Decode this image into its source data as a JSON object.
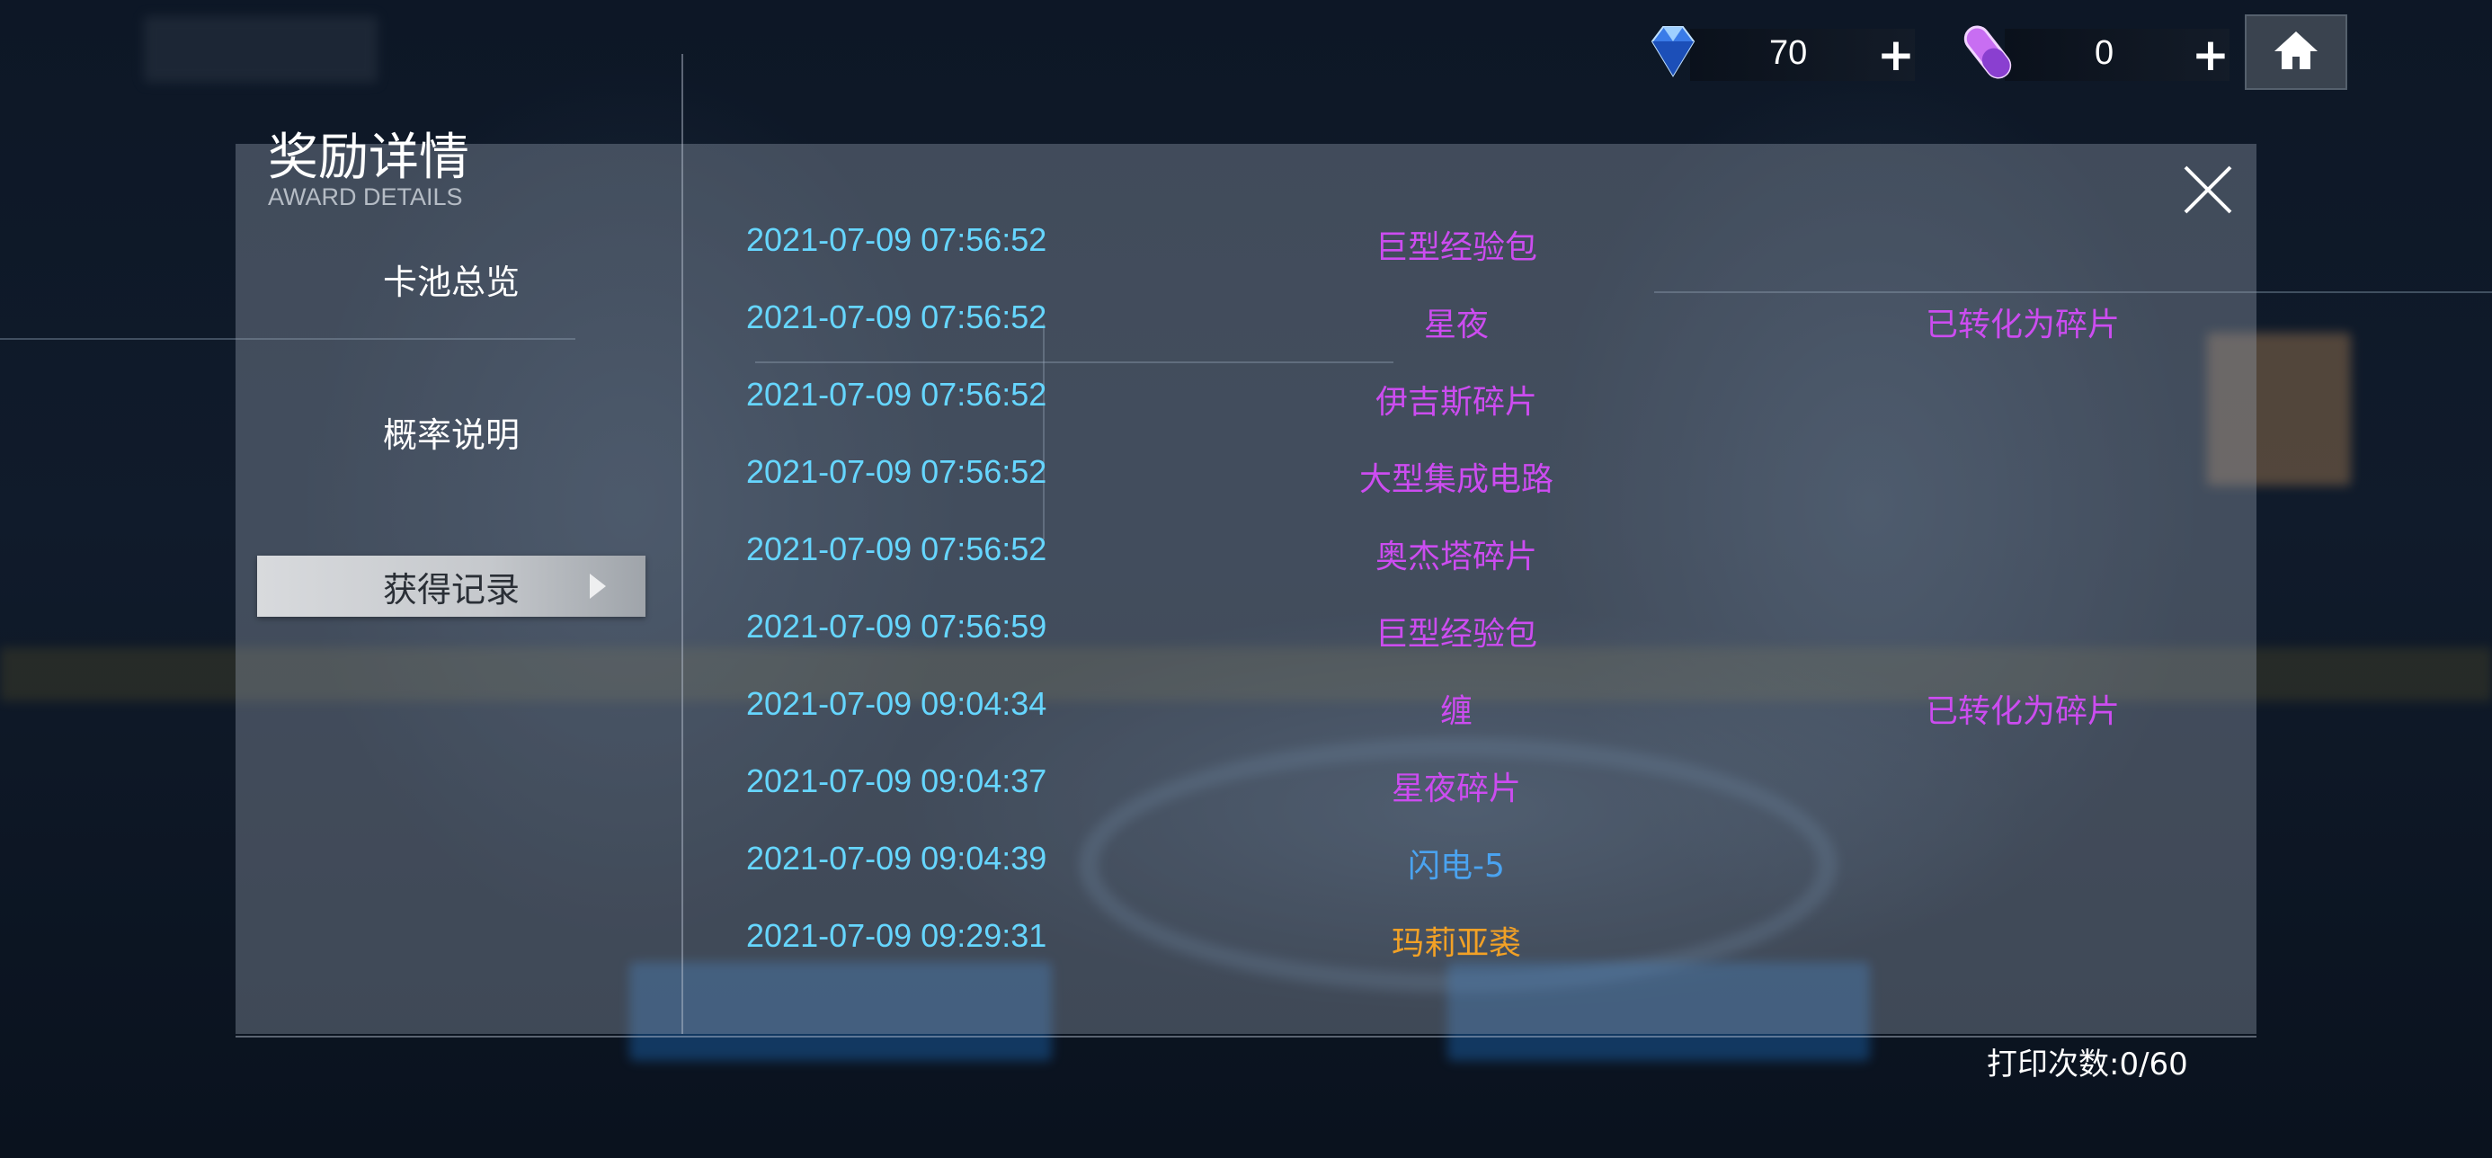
{
  "colors": {
    "time": "#66d6ff",
    "purple_item": "#cc4cf0",
    "blue_item": "#4aa3f0",
    "orange_item": "#f2a126",
    "panel": "rgba(150,160,175,0.38)"
  },
  "currencies": [
    {
      "icon": "diamond-icon",
      "value": "70",
      "plus": "+"
    },
    {
      "icon": "capsule-icon",
      "value": "0",
      "plus": "+"
    }
  ],
  "home_icon": "home-icon",
  "dialog": {
    "title": "奖励详情",
    "subtitle": "AWARD DETAILS",
    "close_icon": "close-icon"
  },
  "menu": {
    "items": [
      {
        "label": "卡池总览",
        "active": false
      },
      {
        "label": "概率说明",
        "active": false
      },
      {
        "label": "获得记录",
        "active": true
      }
    ]
  },
  "records": [
    {
      "time": "2021-07-09 07:56:52",
      "name": "巨型经验包",
      "note": "",
      "color": "purple"
    },
    {
      "time": "2021-07-09 07:56:52",
      "name": "星夜",
      "note": "已转化为碎片",
      "color": "purple"
    },
    {
      "time": "2021-07-09 07:56:52",
      "name": "伊吉斯碎片",
      "note": "",
      "color": "purple"
    },
    {
      "time": "2021-07-09 07:56:52",
      "name": "大型集成电路",
      "note": "",
      "color": "purple"
    },
    {
      "time": "2021-07-09 07:56:52",
      "name": "奥杰塔碎片",
      "note": "",
      "color": "purple"
    },
    {
      "time": "2021-07-09 07:56:59",
      "name": "巨型经验包",
      "note": "",
      "color": "purple"
    },
    {
      "time": "2021-07-09 09:04:34",
      "name": "缠",
      "note": "已转化为碎片",
      "color": "purple"
    },
    {
      "time": "2021-07-09 09:04:37",
      "name": "星夜碎片",
      "note": "",
      "color": "purple"
    },
    {
      "time": "2021-07-09 09:04:39",
      "name": "闪电-5",
      "note": "",
      "color": "blue"
    },
    {
      "time": "2021-07-09 09:29:31",
      "name": "玛莉亚裘",
      "note": "",
      "color": "orange"
    }
  ],
  "footer": {
    "print_count": "打印次数:0/60"
  }
}
